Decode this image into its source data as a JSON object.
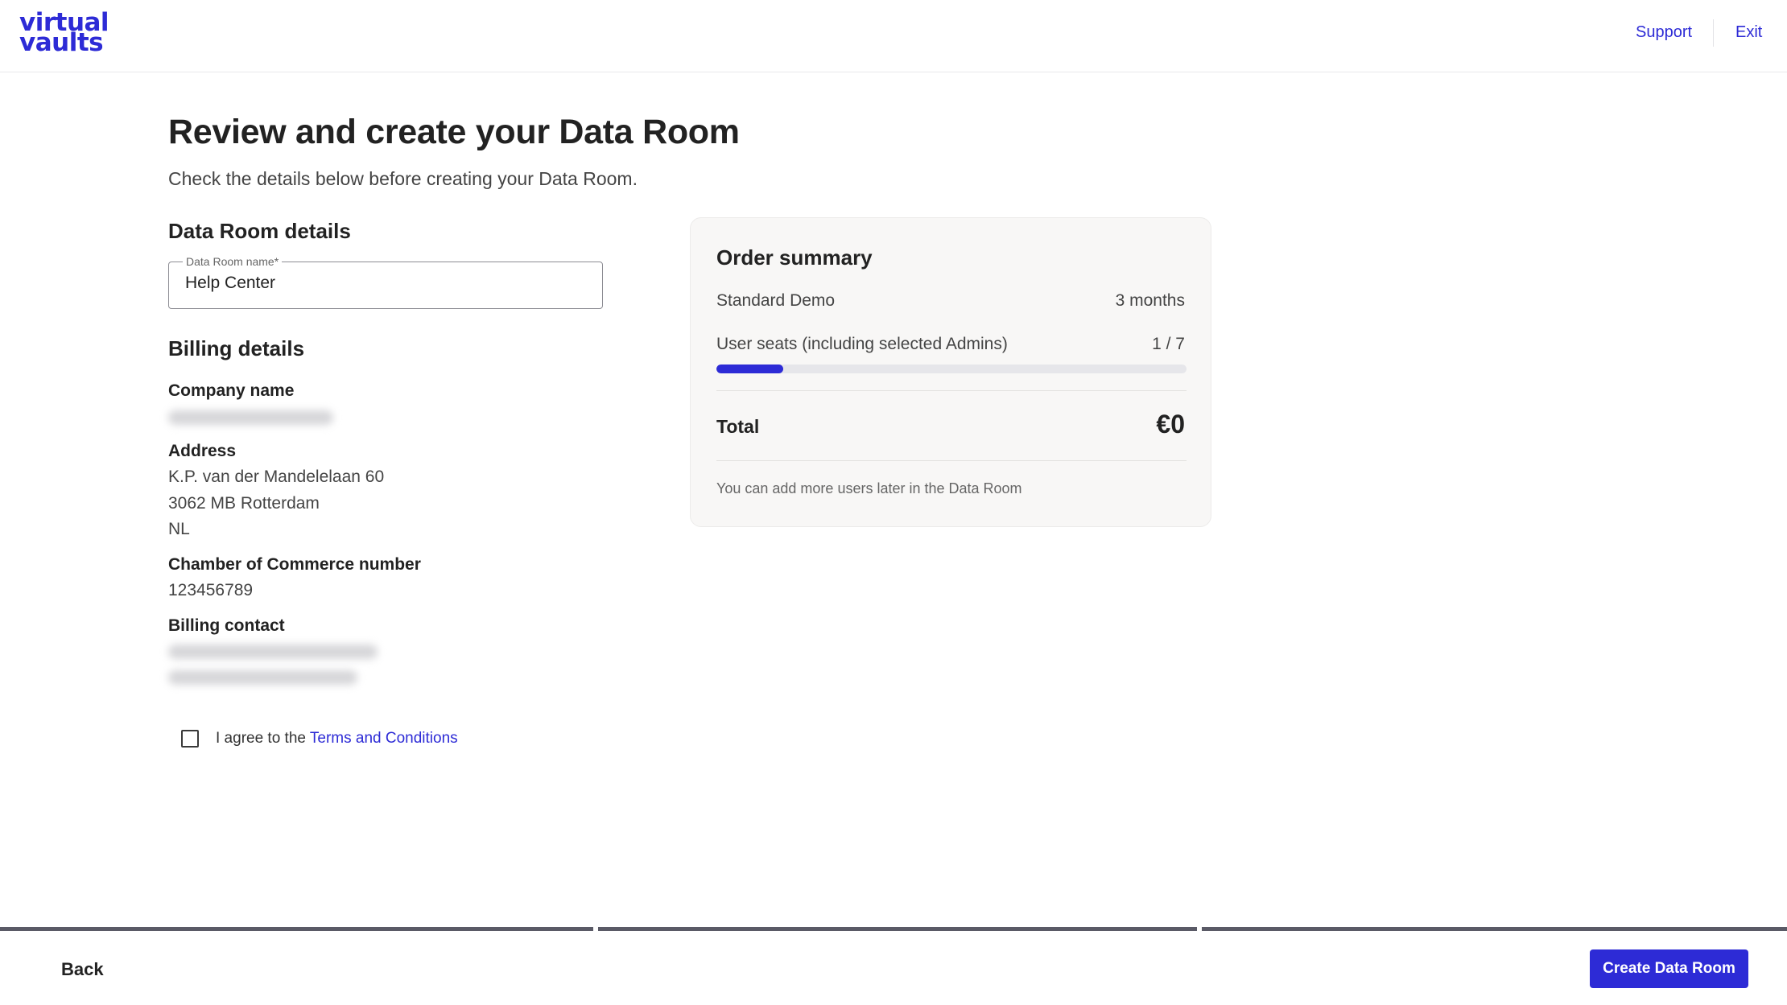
{
  "header": {
    "logo_line1": "virtual",
    "logo_line2": "vaults",
    "support_label": "Support",
    "exit_label": "Exit"
  },
  "main": {
    "title": "Review and create your Data Room",
    "subtitle": "Check the details below before creating your Data Room."
  },
  "data_room": {
    "section_title": "Data Room details",
    "name_label": "Data Room name*",
    "name_value": "Help Center"
  },
  "billing": {
    "section_title": "Billing details",
    "company_label": "Company name",
    "address_label": "Address",
    "address_line1": "K.P. van der Mandelelaan 60",
    "address_line2": "3062 MB Rotterdam",
    "address_line3": "NL",
    "coc_label": "Chamber of Commerce number",
    "coc_value": "123456789",
    "contact_label": "Billing contact"
  },
  "agreement": {
    "prefix": "I agree to the ",
    "link": "Terms and Conditions",
    "checked": false
  },
  "order_summary": {
    "title": "Order summary",
    "plan_name": "Standard Demo",
    "plan_duration": "3 months",
    "seats_label": "User seats (including selected Admins)",
    "seats_value": "1 / 7",
    "seats_used": 1,
    "seats_total": 7,
    "total_label": "Total",
    "total_value": "€0",
    "note": "You can add more users later in the Data Room"
  },
  "footer": {
    "back_label": "Back",
    "create_label": "Create Data Room"
  },
  "colors": {
    "accent": "#2d2bd6",
    "text": "#222222",
    "card_bg": "#f8f7f6"
  }
}
